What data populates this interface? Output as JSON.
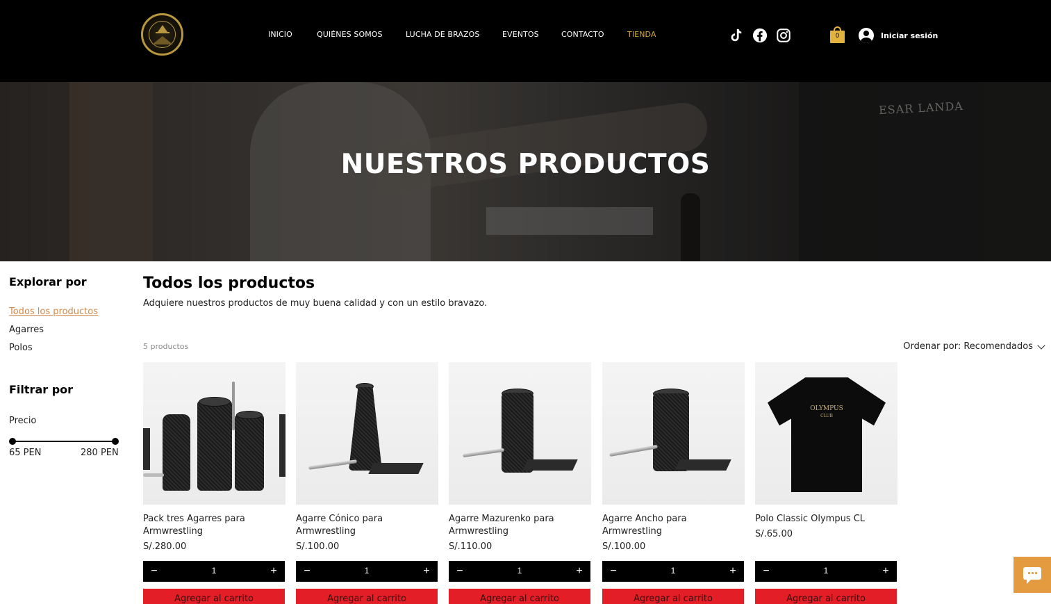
{
  "header": {
    "nav": [
      {
        "label": "INICIO"
      },
      {
        "label": "QUIÉNES SOMOS"
      },
      {
        "label": "LUCHA DE BRAZOS"
      },
      {
        "label": "EVENTOS"
      },
      {
        "label": "CONTACTO"
      },
      {
        "label": "TIENDA",
        "active": true
      }
    ],
    "social": [
      "tiktok-icon",
      "facebook-icon",
      "instagram-icon"
    ],
    "cart_count": "0",
    "login_label": "Iniciar sesión",
    "accent_color": "#d5a73b"
  },
  "hero": {
    "title": "NUESTROS PRODUCTOS",
    "background_text": "ESAR LANDA"
  },
  "sidebar": {
    "explore_title": "Explorar por",
    "categories": [
      {
        "label": "Todos los productos",
        "active": true
      },
      {
        "label": "Agarres"
      },
      {
        "label": "Polos"
      }
    ],
    "filter_title": "Filtrar por",
    "price_label": "Precio",
    "price_min": "65 PEN",
    "price_max": "280 PEN"
  },
  "main": {
    "title": "Todos los productos",
    "description": "Adquiere nuestros productos de muy buena calidad y con un estilo bravazo.",
    "count": "5 productos",
    "sort_label": "Ordenar por: Recomendados"
  },
  "products": [
    {
      "name": "Pack tres Agarres para Armwrestling",
      "price": "S/.280.00",
      "qty": "1",
      "add_label": "Agregar al carrito"
    },
    {
      "name": "Agarre Cónico para Armwrestling",
      "price": "S/.100.00",
      "qty": "1",
      "add_label": "Agregar al carrito"
    },
    {
      "name": "Agarre Mazurenko para Armwrestling",
      "price": "S/.110.00",
      "qty": "1",
      "add_label": "Agregar al carrito"
    },
    {
      "name": "Agarre Ancho para Armwrestling",
      "price": "S/.100.00",
      "qty": "1",
      "add_label": "Agregar al carrito"
    },
    {
      "name": "Polo Classic Olympus CL",
      "price": "S/.65.00",
      "qty": "1",
      "add_label": "Agregar al carrito"
    }
  ],
  "polo_print": {
    "line1": "OLYMPUS",
    "line2": "CLUB"
  },
  "colors": {
    "add_button": "#e41e26",
    "chat_button": "#e49a3f",
    "active_category": "#d4894a"
  }
}
